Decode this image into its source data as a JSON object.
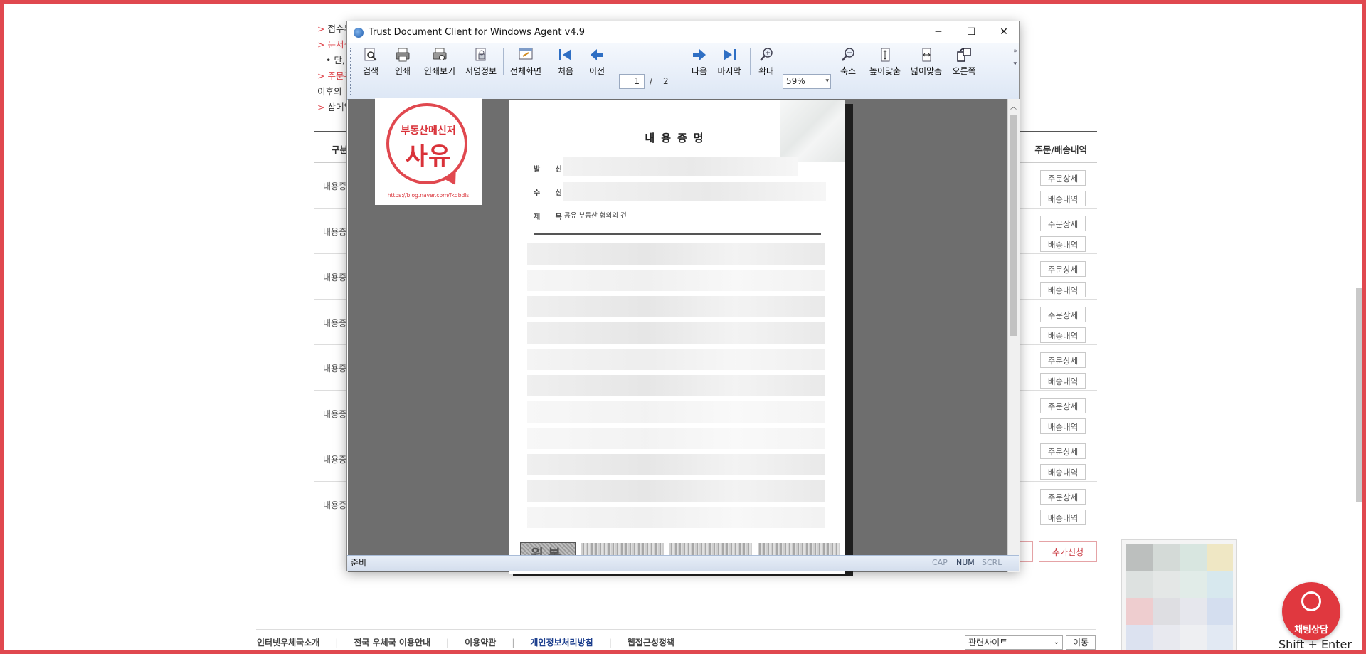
{
  "background_page": {
    "notice_lines": [
      {
        "prefix": ">",
        "text": "접수부",
        "style": "normal"
      },
      {
        "prefix": ">",
        "text": "문서결",
        "style": "red"
      },
      {
        "prefix": "",
        "text": "• 단,",
        "style": "normal"
      },
      {
        "prefix": ">",
        "text": "주문취",
        "style": "red"
      },
      {
        "prefix": "",
        "text": "이후의",
        "style": "normal"
      },
      {
        "prefix": ">",
        "text": "삼메일",
        "style": "normal"
      }
    ],
    "table": {
      "col_type_header": "구분",
      "col_actions_header": "주문/배송내역",
      "rows": [
        {
          "type": "내용증",
          "detail_btn": "주문상세",
          "delivery_btn": "배송내역"
        },
        {
          "type": "내용증",
          "detail_btn": "주문상세",
          "delivery_btn": "배송내역"
        },
        {
          "type": "내용증",
          "detail_btn": "주문상세",
          "delivery_btn": "배송내역"
        },
        {
          "type": "내용증",
          "detail_btn": "주문상세",
          "delivery_btn": "배송내역"
        },
        {
          "type": "내용증",
          "detail_btn": "주문상세",
          "delivery_btn": "배송내역"
        },
        {
          "type": "내용증",
          "detail_btn": "주문상세",
          "delivery_btn": "배송내역"
        },
        {
          "type": "내용증",
          "detail_btn": "주문상세",
          "delivery_btn": "배송내역"
        },
        {
          "type": "내용증",
          "detail_btn": "주문상세",
          "delivery_btn": "배송내역"
        }
      ]
    },
    "add_request_btn": "추가신청",
    "footer": {
      "links": [
        "인터넷우체국소개",
        "전국 우체국 이용안내",
        "이용약관",
        "개인정보처리방침",
        "웹접근성정책"
      ],
      "related_sites": "관련사이트",
      "go_btn": "이동"
    },
    "chat": {
      "label": "채팅상담",
      "shortcut": "Shift + Enter"
    }
  },
  "viewer": {
    "title": "Trust Document Client for Windows Agent v4.9",
    "toolbar": {
      "search": "검색",
      "print": "인쇄",
      "print_preview": "인쇄보기",
      "signature_info": "서명정보",
      "fullscreen": "전체화면",
      "first": "처음",
      "prev": "이전",
      "current_page": "1",
      "page_sep": "/",
      "total_pages": "2",
      "next": "다음",
      "last": "마지막",
      "zoom_in": "확대",
      "zoom_value": "59%",
      "zoom_out": "축소",
      "fit_height": "높이맞춤",
      "fit_width": "넓이맞춤",
      "rotate_right": "오른쪽"
    },
    "document": {
      "title": "내용증명",
      "sender_label": "발 신",
      "receiver_label": "수 신",
      "subject_label": "제 목",
      "subject_value": "공유 부동산 협의의 건",
      "stamp_text": "원본"
    },
    "status": {
      "text": "준비",
      "cap": "CAP",
      "num": "NUM",
      "scrl": "SCRL"
    }
  },
  "logo": {
    "top_text": "부동산메신저",
    "big_text": "사유",
    "url": "https://blog.naver.com/fkdbdls"
  },
  "colors": {
    "accent_red": "#e0484f",
    "toolbar_blue": "#dde7f5"
  }
}
